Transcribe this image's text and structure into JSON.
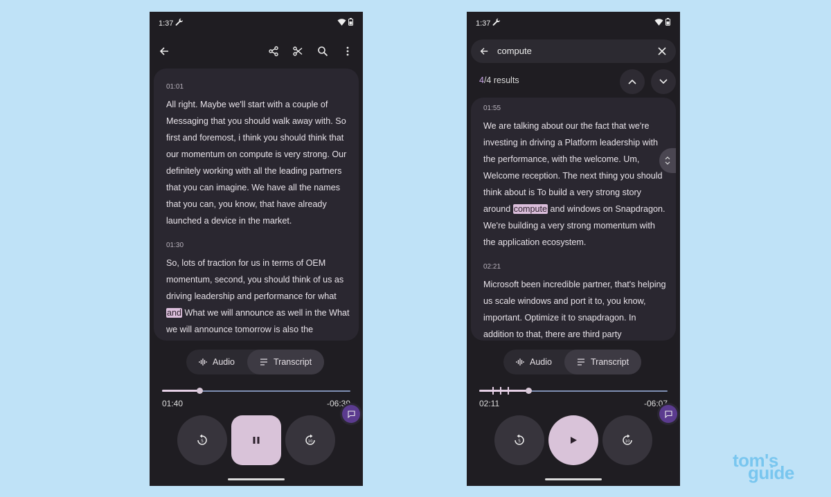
{
  "status": {
    "time": "1:37"
  },
  "left": {
    "segments": [
      {
        "timestamp": "01:01",
        "text": "All right. Maybe we'll start with a couple of Messaging that you should walk away with. So first and foremost, i think you should think that our momentum on compute is very strong. Our definitely working with all the leading partners that you can imagine. We have all the names that you can, you know, that have already launched a device in the market."
      },
      {
        "timestamp": "01:30",
        "text_before": "So, lots of traction for us in terms of OEM momentum, second, you should think of us as driving leadership and performance for what ",
        "highlight": "and",
        "text_after": " What we will announce as well in the What we will announce tomorrow is also the"
      }
    ],
    "tabs": {
      "audio": "Audio",
      "transcript": "Transcript",
      "active": "transcript"
    },
    "playback": {
      "elapsed": "01:40",
      "remaining": "-06:39",
      "progress": 0.2,
      "state": "playing"
    }
  },
  "right": {
    "search": {
      "query": "compute"
    },
    "results": {
      "current": "4",
      "rest": "/4 results"
    },
    "segments": [
      {
        "timestamp": "01:55",
        "text_before": "We are talking about our the fact that we're investing in driving a Platform leadership with the performance, with the welcome. Um, Welcome reception. The next thing you should think about is To build a very strong story around ",
        "highlight": "compute",
        "text_after": " and windows on Snapdragon. We're building a very strong momentum with the application ecosystem."
      },
      {
        "timestamp": "02:21",
        "text": "Microsoft been incredible partner, that's helping us scale windows and port it to, you know, important. Optimize it to snapdragon. In addition to that, there are third party"
      }
    ],
    "tabs": {
      "audio": "Audio",
      "transcript": "Transcript",
      "active": "transcript"
    },
    "playback": {
      "elapsed": "02:11",
      "remaining": "-06:07",
      "progress": 0.26,
      "state": "paused",
      "match_marks": [
        0.07,
        0.11,
        0.15
      ]
    }
  },
  "watermark": {
    "line1": "tom's",
    "line2": "guide"
  },
  "colors": {
    "background": "#bfe2f7",
    "phone": "#1f1d22",
    "card": "#2a2730",
    "accent": "#d9c3d9",
    "highlight": "#dcbfdc",
    "logo": "#79c6ef"
  }
}
